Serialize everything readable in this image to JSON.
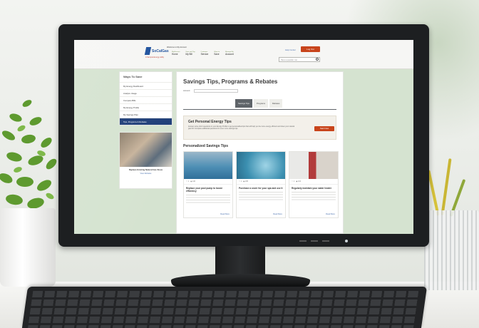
{
  "header": {
    "logo_text": "SoCalGas",
    "logo_sub": "A Sempra Energy utility",
    "welcome": "Welcome to My Account",
    "nav": [
      {
        "cap": "My Account",
        "main": "Home"
      },
      {
        "cap": "View and Pay",
        "main": "My Bill"
      },
      {
        "cap": "Customer",
        "main": "Service"
      },
      {
        "cap": "Ways to",
        "main": "Save"
      },
      {
        "cap": "Manage My",
        "main": "Account"
      }
    ],
    "help_link": "Help Center",
    "logout_label": "Log Out",
    "search_placeholder": "Have a question, too"
  },
  "sidebar": {
    "title": "Ways To Save",
    "items": [
      {
        "label": "My Energy Dashboard"
      },
      {
        "label": "Analyze Usage"
      },
      {
        "label": "Compare Bills"
      },
      {
        "label": "My Energy Profile"
      },
      {
        "label": "My Savings Plan"
      },
      {
        "label": "Tips, Programs & Rebates"
      }
    ],
    "promo": {
      "title": "Replace Existing Natural Gas Stove",
      "link": "View Rebates"
    }
  },
  "content": {
    "title": "Savings Tips, Programs & Rebates",
    "account_label": "Account:",
    "tabs": [
      "Savings Tips",
      "Programs",
      "Rebates"
    ],
    "tipbox": {
      "title": "Get Personal Energy Tips",
      "text": "Answer some short questions in your Energy Profile to get personalized tips that will help you be more energy efficient and lower your natural gas bill. Complete additional questions for even more savings tips.",
      "button": "Start Now"
    },
    "section_title": "Personalized Savings Tips",
    "cards": [
      {
        "likes": "1",
        "views": "146",
        "title": "Replace your pool pump to boost efficiency",
        "link": "Read More"
      },
      {
        "likes": "1",
        "views": "195",
        "title": "Purchase a cover for your spa and use it",
        "link": "Read More"
      },
      {
        "likes": "1",
        "views": "134",
        "title": "Regularly maintain your water heater",
        "link": "Read More"
      }
    ]
  },
  "colors": {
    "brand_blue": "#1b4f9c",
    "accent_orange": "#c8441b",
    "active_nav": "#1e3e78",
    "screen_bg": "#d5e3d0"
  }
}
